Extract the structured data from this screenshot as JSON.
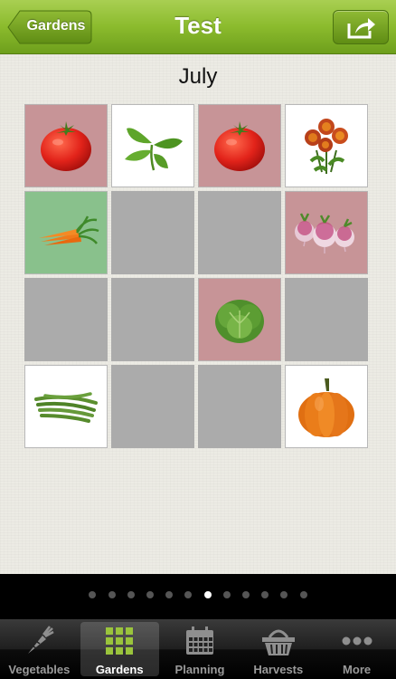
{
  "navbar": {
    "title": "Test",
    "back_label": "Gardens",
    "share_icon": "share-icon"
  },
  "garden": {
    "month": "July",
    "cells": [
      {
        "plant": "tomato",
        "bg": "red"
      },
      {
        "plant": "basil",
        "bg": "white"
      },
      {
        "plant": "tomato",
        "bg": "red"
      },
      {
        "plant": "marigold",
        "bg": "white"
      },
      {
        "plant": "carrot",
        "bg": "green"
      },
      {
        "plant": "",
        "bg": "empty"
      },
      {
        "plant": "",
        "bg": "empty"
      },
      {
        "plant": "turnip",
        "bg": "red"
      },
      {
        "plant": "",
        "bg": "empty"
      },
      {
        "plant": "",
        "bg": "empty"
      },
      {
        "plant": "lettuce",
        "bg": "red"
      },
      {
        "plant": "",
        "bg": "empty"
      },
      {
        "plant": "green-beans",
        "bg": "white"
      },
      {
        "plant": "",
        "bg": "empty"
      },
      {
        "plant": "",
        "bg": "empty"
      },
      {
        "plant": "pumpkin",
        "bg": "white"
      }
    ]
  },
  "pager": {
    "count": 12,
    "active": 6
  },
  "tabbar": {
    "items": [
      {
        "label": "Vegetables",
        "icon": "carrot-icon",
        "selected": false
      },
      {
        "label": "Gardens",
        "icon": "grid-icon",
        "selected": true
      },
      {
        "label": "Planning",
        "icon": "calendar-icon",
        "selected": false
      },
      {
        "label": "Harvests",
        "icon": "basket-icon",
        "selected": false
      },
      {
        "label": "More",
        "icon": "more-icon",
        "selected": false
      }
    ]
  },
  "colors": {
    "nav_green": "#8bbb2d",
    "cell_red": "#c79497",
    "cell_green": "#89c18c",
    "cell_empty": "#ababab"
  }
}
